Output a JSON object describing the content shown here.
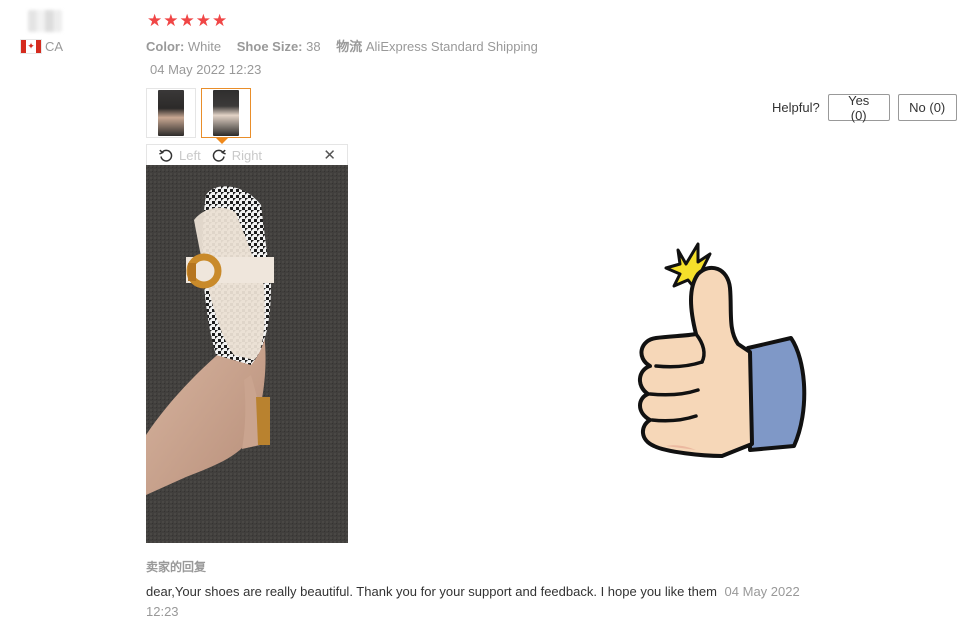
{
  "reviewer": {
    "country_code": "CA",
    "flag_glyph": "✦"
  },
  "review": {
    "rating": 5,
    "stars": [
      "★",
      "★",
      "★",
      "★",
      "★"
    ],
    "attributes": [
      {
        "label": "Color:",
        "value": "White"
      },
      {
        "label": "Shoe Size:",
        "value": "38"
      },
      {
        "label": "物流",
        "value": "AliExpress Standard Shipping"
      }
    ],
    "date": "04 May 2022 12:23"
  },
  "viewer": {
    "rotate_left_label": "Left",
    "rotate_right_label": "Right",
    "close_glyph": "✕"
  },
  "helpful": {
    "label": "Helpful?",
    "yes_label": "Yes (0)",
    "no_label": "No (0)"
  },
  "seller_reply": {
    "label": "卖家的回复",
    "text": "dear,Your shoes are really beautiful. Thank you for your support and feedback. I hope you like them",
    "date": "04 May 2022 12:23"
  },
  "colors": {
    "star": "#f04646",
    "active_thumb_border": "#e98e2a",
    "muted_text": "#999999"
  }
}
